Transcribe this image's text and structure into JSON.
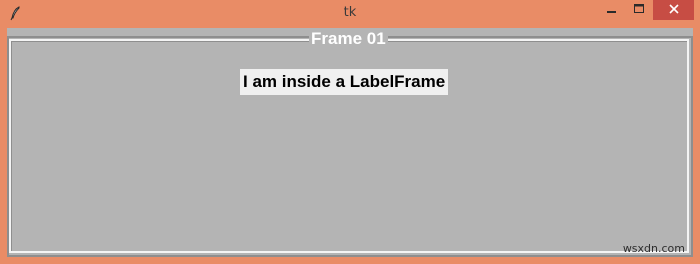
{
  "window": {
    "title": "tk",
    "minimize_icon": "minimize-icon",
    "maximize_icon": "maximize-icon",
    "close_icon": "close-icon",
    "app_icon": "feather-icon"
  },
  "labelframe": {
    "text": "Frame 01"
  },
  "content": {
    "label_text": "I am inside a LabelFrame"
  },
  "watermark": "wsxdn.com",
  "colors": {
    "titlebar": "#e98c66",
    "close_button": "#c74d44",
    "frame_background": "#b4b4b4",
    "label_background": "#f0f0f0"
  }
}
